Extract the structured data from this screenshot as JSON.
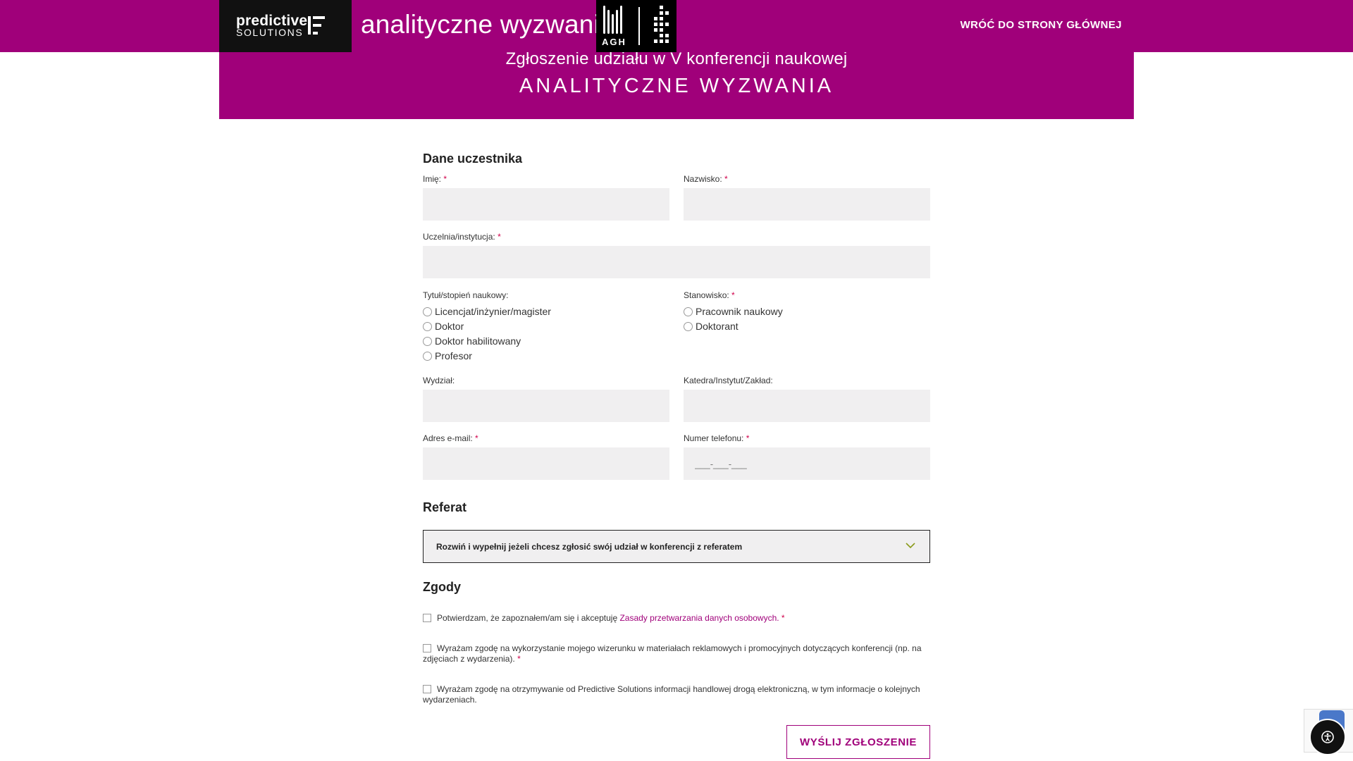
{
  "header": {
    "logo_top": "predictive",
    "logo_bottom": "SOLUTIONS",
    "site_title": "analityczne wyzwania",
    "agh_label": "AGH",
    "home_link": "WRÓĆ DO STRONY GŁÓWNEJ"
  },
  "banner": {
    "subtitle": "Zgłoszenie udziału w V konferencji naukowej",
    "title": "ANALITYCZNE WYZWANIA"
  },
  "form": {
    "section_participant": "Dane uczestnika",
    "first_name_label": "Imię:",
    "last_name_label": "Nazwisko:",
    "institution_label": "Uczelnia/instytucja:",
    "degree_label": "Tytuł/stopień naukowy:",
    "degree_options": [
      "Licencjat/inżynier/magister",
      "Doktor",
      "Doktor habilitowany",
      "Profesor"
    ],
    "position_label": "Stanowisko:",
    "position_options": [
      "Pracownik naukowy",
      "Doktorant"
    ],
    "faculty_label": "Wydział:",
    "department_label": "Katedra/Instytut/Zakład:",
    "email_label": "Adres e-mail:",
    "phone_label": "Numer telefonu:",
    "phone_placeholder": "___-___-___",
    "required_mark": "*",
    "section_paper": "Referat",
    "paper_toggle": "Rozwiń i wypełnij jeżeli chcesz zgłosić swój udział w konferencji z referatem",
    "section_consents": "Zgody",
    "consent1_text": "Potwierdzam, że zapoznałem/am się i akceptuję ",
    "consent1_link": "Zasady przetwarzania danych osobowych.",
    "consent2_text": "Wyrażam zgodę na wykorzystanie mojego wizerunku w materiałach reklamowych i promocyjnych dotyczących konferencji (np. na zdjęciach z wydarzenia).",
    "consent3_text": "Wyrażam zgodę na otrzymywanie od Predictive Solutions informacji handlowej drogą elektroniczną, w tym informacje o kolejnych wydarzeniach.",
    "submit_label": "WYŚLIJ ZGŁOSZENIE"
  },
  "colors": {
    "brand": "#a0007a",
    "required": "#d0004a",
    "field_bg": "#f0eff0"
  },
  "icons": [
    "predictive-solutions-logo",
    "agh-logo",
    "chevron-down-icon",
    "recaptcha-icon",
    "accessibility-icon"
  ]
}
